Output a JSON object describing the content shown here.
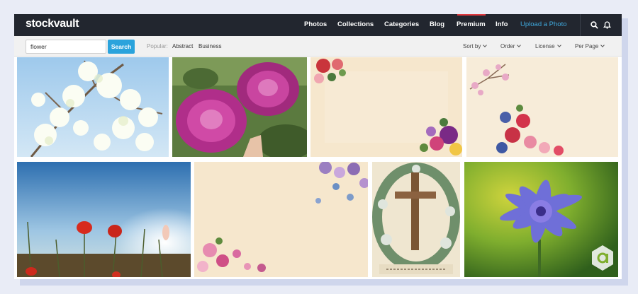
{
  "brand": {
    "logo": "stockvault"
  },
  "nav": {
    "items": [
      {
        "label": "Photos"
      },
      {
        "label": "Collections"
      },
      {
        "label": "Categories"
      },
      {
        "label": "Blog"
      },
      {
        "label": "Premium"
      },
      {
        "label": "Info"
      },
      {
        "label": "Upload a Photo"
      }
    ],
    "icons": [
      "search-icon",
      "bell-icon"
    ],
    "accent_color": "#3fa9de",
    "premium_marker_color": "#e0393e"
  },
  "search": {
    "value": "flower",
    "button_label": "Search"
  },
  "popular": {
    "label": "Popular:",
    "links": [
      "Abstract",
      "Business"
    ]
  },
  "filters": [
    "Sort by",
    "Order",
    "License",
    "Per Page"
  ],
  "gallery": {
    "row1": [
      "cherry-blossom",
      "pink-roses",
      "vintage-floral-corners",
      "vintage-pink-branch"
    ],
    "row2": [
      "red-poppies-sky",
      "vintage-floral-pink",
      "vintage-easter-cross",
      "purple-cornflower"
    ],
    "watermark_icon": "a-logo-icon"
  }
}
